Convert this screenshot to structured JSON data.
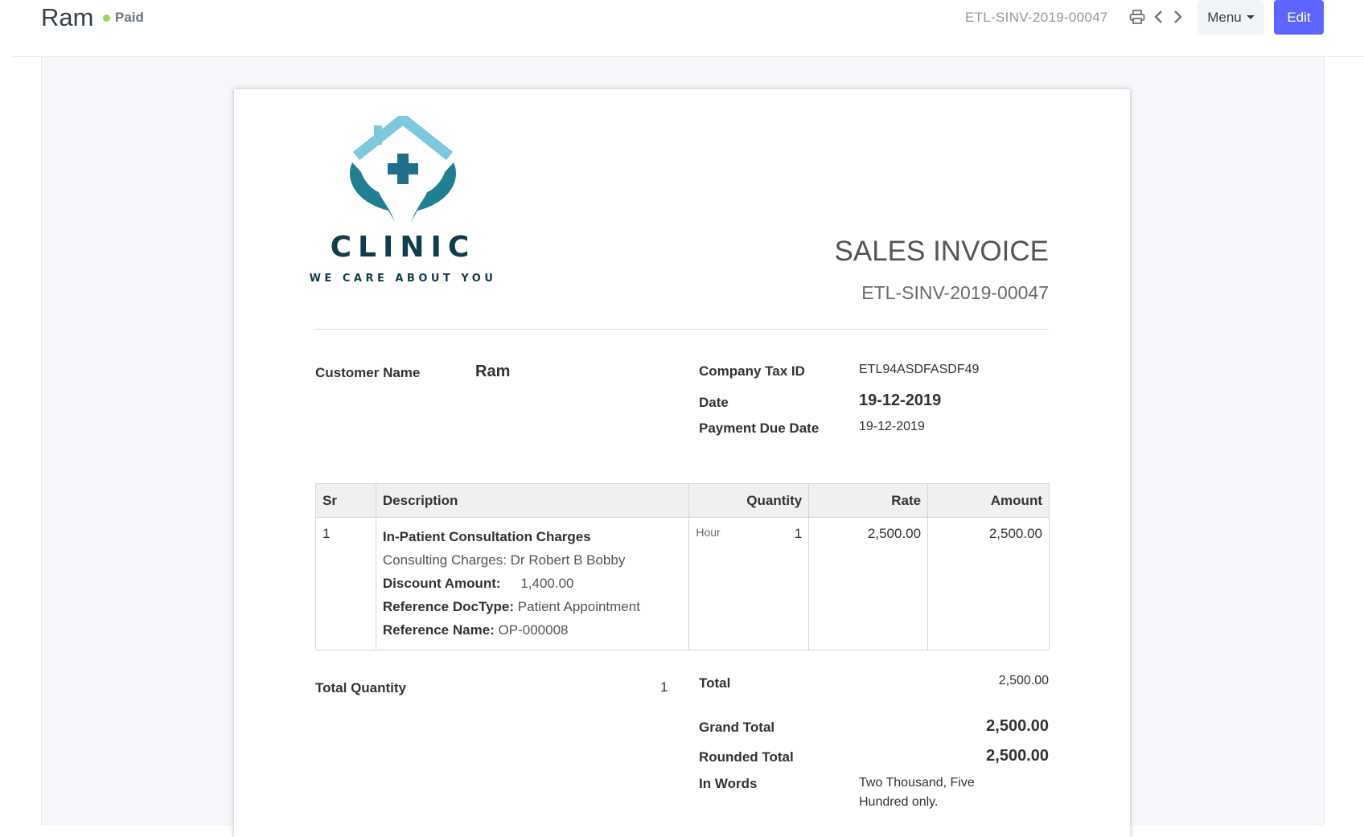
{
  "header": {
    "title": "Ram",
    "status": "Paid",
    "doc_name": "ETL-SINV-2019-00047",
    "menu_label": "Menu",
    "edit_label": "Edit",
    "accent": "#5e64ff",
    "status_color": "#98d85b"
  },
  "icons": [
    "printer-icon",
    "chevron-left-icon",
    "chevron-right-icon"
  ],
  "invoice": {
    "logo_text": "CLINIC",
    "logo_tagline": "WE CARE ABOUT YOU",
    "heading": "SALES INVOICE",
    "name": "ETL-SINV-2019-00047",
    "customer_name_label": "Customer Name",
    "customer_name": "Ram",
    "company_tax_id_label": "Company Tax ID",
    "company_tax_id": "ETL94ASDFASDF49",
    "date_label": "Date",
    "date": "19-12-2019",
    "due_date_label": "Payment Due Date",
    "due_date": "19-12-2019",
    "table": {
      "headers": [
        "Sr",
        "Description",
        "Quantity",
        "Rate",
        "Amount"
      ],
      "rows": [
        {
          "sr": "1",
          "item": "In-Patient Consultation Charges",
          "desc": "Consulting Charges: Dr Robert B Bobby",
          "discount_label": "Discount Amount:",
          "discount": "1,400.00",
          "ref_doctype_label": "Reference DocType:",
          "ref_doctype": "Patient Appointment",
          "ref_name_label": "Reference Name:",
          "ref_name": "OP-000008",
          "uom": "Hour",
          "qty": "1",
          "rate": "2,500.00",
          "amount": "2,500.00"
        }
      ]
    },
    "total_qty_label": "Total Quantity",
    "total_qty": "1",
    "total_label": "Total",
    "total": "2,500.00",
    "grand_total_label": "Grand Total",
    "grand_total": "2,500.00",
    "rounded_total_label": "Rounded Total",
    "rounded_total": "2,500.00",
    "in_words_label": "In Words",
    "in_words_1": "Two Thousand, Five",
    "in_words_2": "Hundred only."
  }
}
